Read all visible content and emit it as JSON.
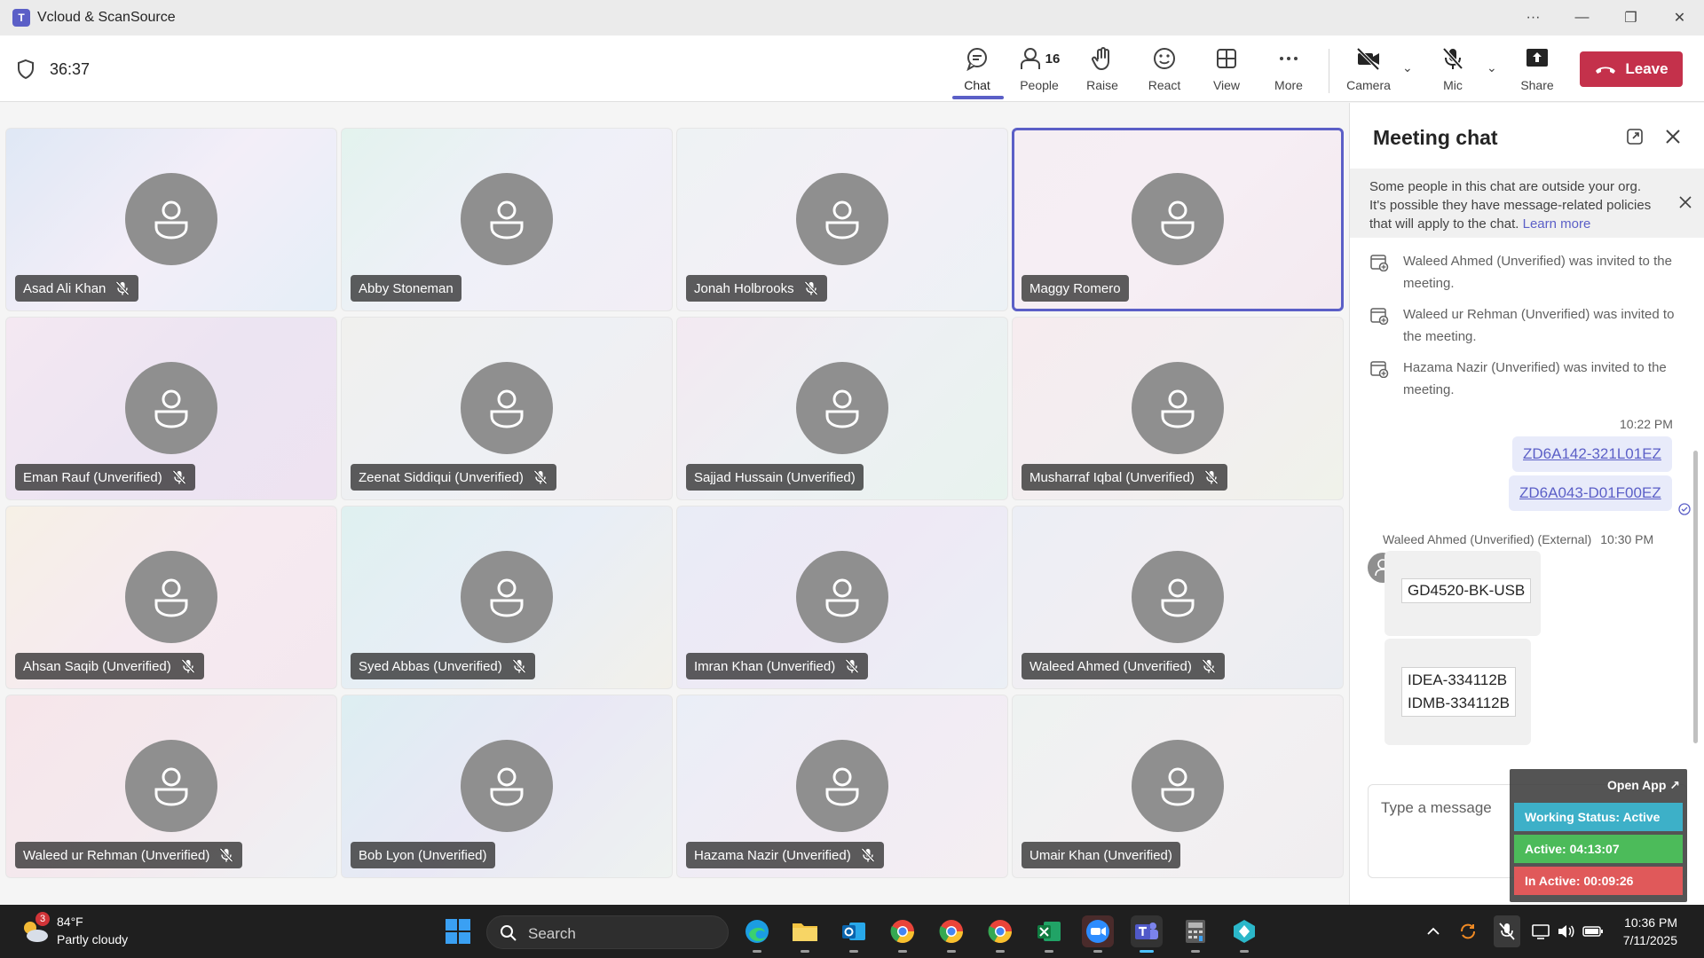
{
  "window": {
    "title": "Vcloud & ScanSource"
  },
  "toolbar": {
    "timer": "36:37",
    "tools": [
      {
        "id": "chat",
        "label": "Chat",
        "icon": "chat-icon"
      },
      {
        "id": "people",
        "label": "People",
        "icon": "people-icon",
        "count": "16"
      },
      {
        "id": "raise",
        "label": "Raise",
        "icon": "raise-hand-icon"
      },
      {
        "id": "react",
        "label": "React",
        "icon": "smiley-icon"
      },
      {
        "id": "view",
        "label": "View",
        "icon": "grid-view-icon"
      },
      {
        "id": "more",
        "label": "More",
        "icon": "more-icon"
      },
      {
        "id": "camera",
        "label": "Camera",
        "icon": "camera-off-icon"
      },
      {
        "id": "mic",
        "label": "Mic",
        "icon": "mic-off-icon"
      },
      {
        "id": "share",
        "label": "Share",
        "icon": "share-icon"
      }
    ],
    "leave_label": "Leave"
  },
  "participants": [
    {
      "name": "Asad Ali Khan",
      "muted": true,
      "speaking": false
    },
    {
      "name": "Abby Stoneman",
      "muted": false,
      "speaking": false
    },
    {
      "name": "Jonah Holbrooks",
      "muted": true,
      "speaking": false
    },
    {
      "name": "Maggy Romero",
      "muted": false,
      "speaking": true
    },
    {
      "name": "Eman Rauf (Unverified)",
      "muted": true,
      "speaking": false
    },
    {
      "name": "Zeenat Siddiqui (Unverified)",
      "muted": true,
      "speaking": false
    },
    {
      "name": "Sajjad Hussain (Unverified)",
      "muted": false,
      "speaking": false
    },
    {
      "name": "Musharraf Iqbal (Unverified)",
      "muted": true,
      "speaking": false
    },
    {
      "name": "Ahsan Saqib (Unverified)",
      "muted": true,
      "speaking": false
    },
    {
      "name": "Syed Abbas (Unverified)",
      "muted": true,
      "speaking": false
    },
    {
      "name": "Imran Khan (Unverified)",
      "muted": true,
      "speaking": false
    },
    {
      "name": "Waleed Ahmed (Unverified)",
      "muted": true,
      "speaking": false
    },
    {
      "name": "Waleed ur Rehman (Unverified)",
      "muted": true,
      "speaking": false
    },
    {
      "name": "Bob Lyon (Unverified)",
      "muted": false,
      "speaking": false
    },
    {
      "name": "Hazama Nazir (Unverified)",
      "muted": true,
      "speaking": false
    },
    {
      "name": "Umair Khan (Unverified)",
      "muted": false,
      "speaking": false
    }
  ],
  "chat": {
    "title": "Meeting chat",
    "notice": "Some people in this chat are outside your org. It's possible they have message-related policies that will apply to the chat.",
    "notice_link": "Learn more",
    "system_messages": [
      {
        "line1": "Waleed Ahmed (Unverified) was invited to the",
        "line2": "meeting."
      },
      {
        "line1": "Waleed ur Rehman (Unverified) was invited to",
        "line2": "the meeting."
      },
      {
        "line1": "Hazama Nazir (Unverified) was invited to the",
        "line2": "meeting."
      }
    ],
    "my_time": "10:22 PM",
    "my_messages": [
      "ZD6A142-321L01EZ",
      "ZD6A043-D01F00EZ"
    ],
    "their_sender": "Waleed Ahmed (Unverified) (External)",
    "their_time": "10:30 PM",
    "their_msg1": "GD4520-BK-USB",
    "their_msg2_lines": [
      "IDEA-334112B",
      "IDMB-334112B"
    ],
    "composer_placeholder": "Type a message"
  },
  "status_widget": {
    "open_label": "Open App ↗",
    "working": "Working Status: Active",
    "active": "Active: 04:13:07",
    "inactive": "In Active: 00:09:26",
    "colors": {
      "working": "#3db0c8",
      "active": "#4cbb5a",
      "inactive": "#e0595a"
    }
  },
  "taskbar": {
    "weather_temp": "84°F",
    "weather_cond": "Partly cloudy",
    "weather_badge": "3",
    "search_label": "Search",
    "time": "10:36 PM",
    "date": "7/11/2025"
  },
  "colors": {
    "accent": "#5b5fc7",
    "leave": "#c4314b"
  }
}
